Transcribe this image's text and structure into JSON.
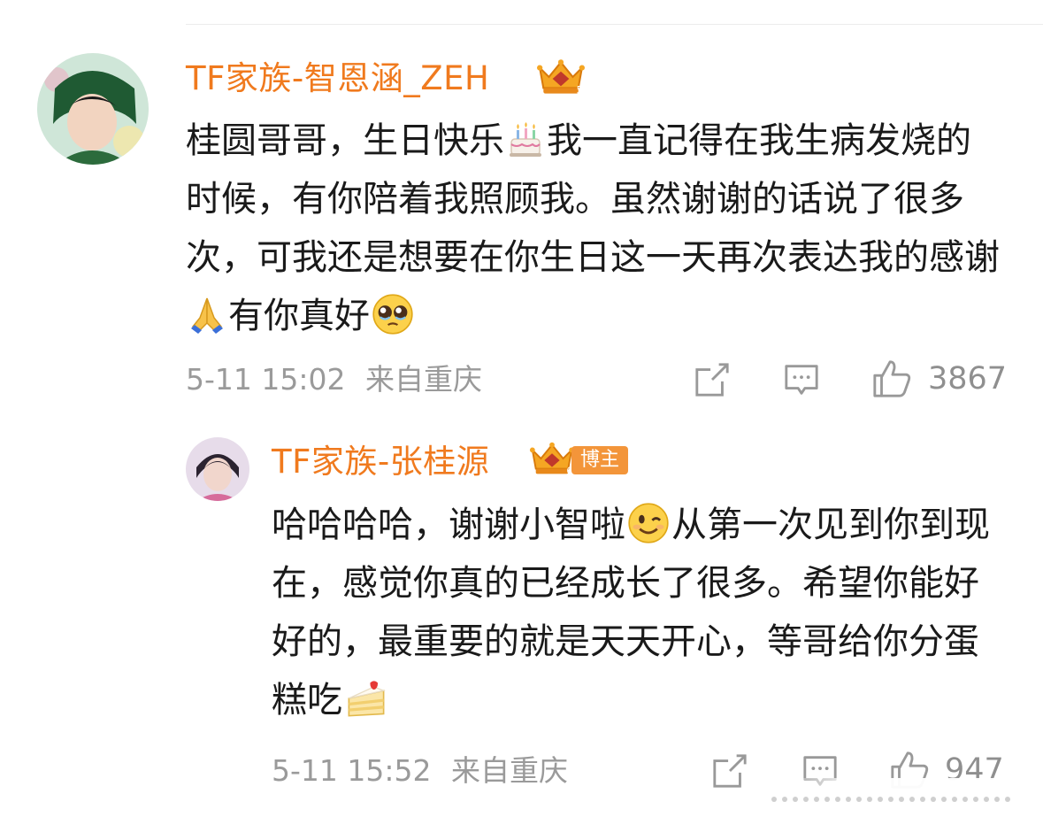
{
  "comments": [
    {
      "username": "TF家族-智恩涵_ZEH",
      "badge_level": "5",
      "content_parts": [
        "桂圆哥哥，生日快乐",
        "我一直记得在我生病发烧的时候，有你陪着我照顾我。虽然谢谢的话说了很多次，可我还是想要在你生日这一天再次表达我的感谢",
        "有你真好"
      ],
      "emojis": [
        "birthday-cake-emoji",
        "folded-hands-emoji",
        "pleading-face-emoji"
      ],
      "date": "5-11 15:02",
      "location": "来自重庆",
      "like_count": "3867"
    },
    {
      "username": "TF家族-张桂源",
      "badge_level": "6",
      "host_tag": "博主",
      "content_parts": [
        "哈哈哈哈，谢谢小智啦",
        "从第一次见到你到现在，感觉你真的已经成长了很多。希望你能好好的，最重要的就是天天开心，等哥给你分蛋糕吃"
      ],
      "emojis": [
        "winking-face-emoji",
        "shortcake-emoji"
      ],
      "date": "5-11 15:52",
      "location": "来自重庆",
      "like_count": "947"
    }
  ],
  "icons": [
    "share-icon",
    "comment-icon",
    "thumb-up-icon",
    "crown-badge-icon"
  ],
  "colors": {
    "username": "#f07a1e",
    "meta": "#9a9a9a",
    "text": "#1a1a1a",
    "host_tag_bg": "#f3953a"
  }
}
